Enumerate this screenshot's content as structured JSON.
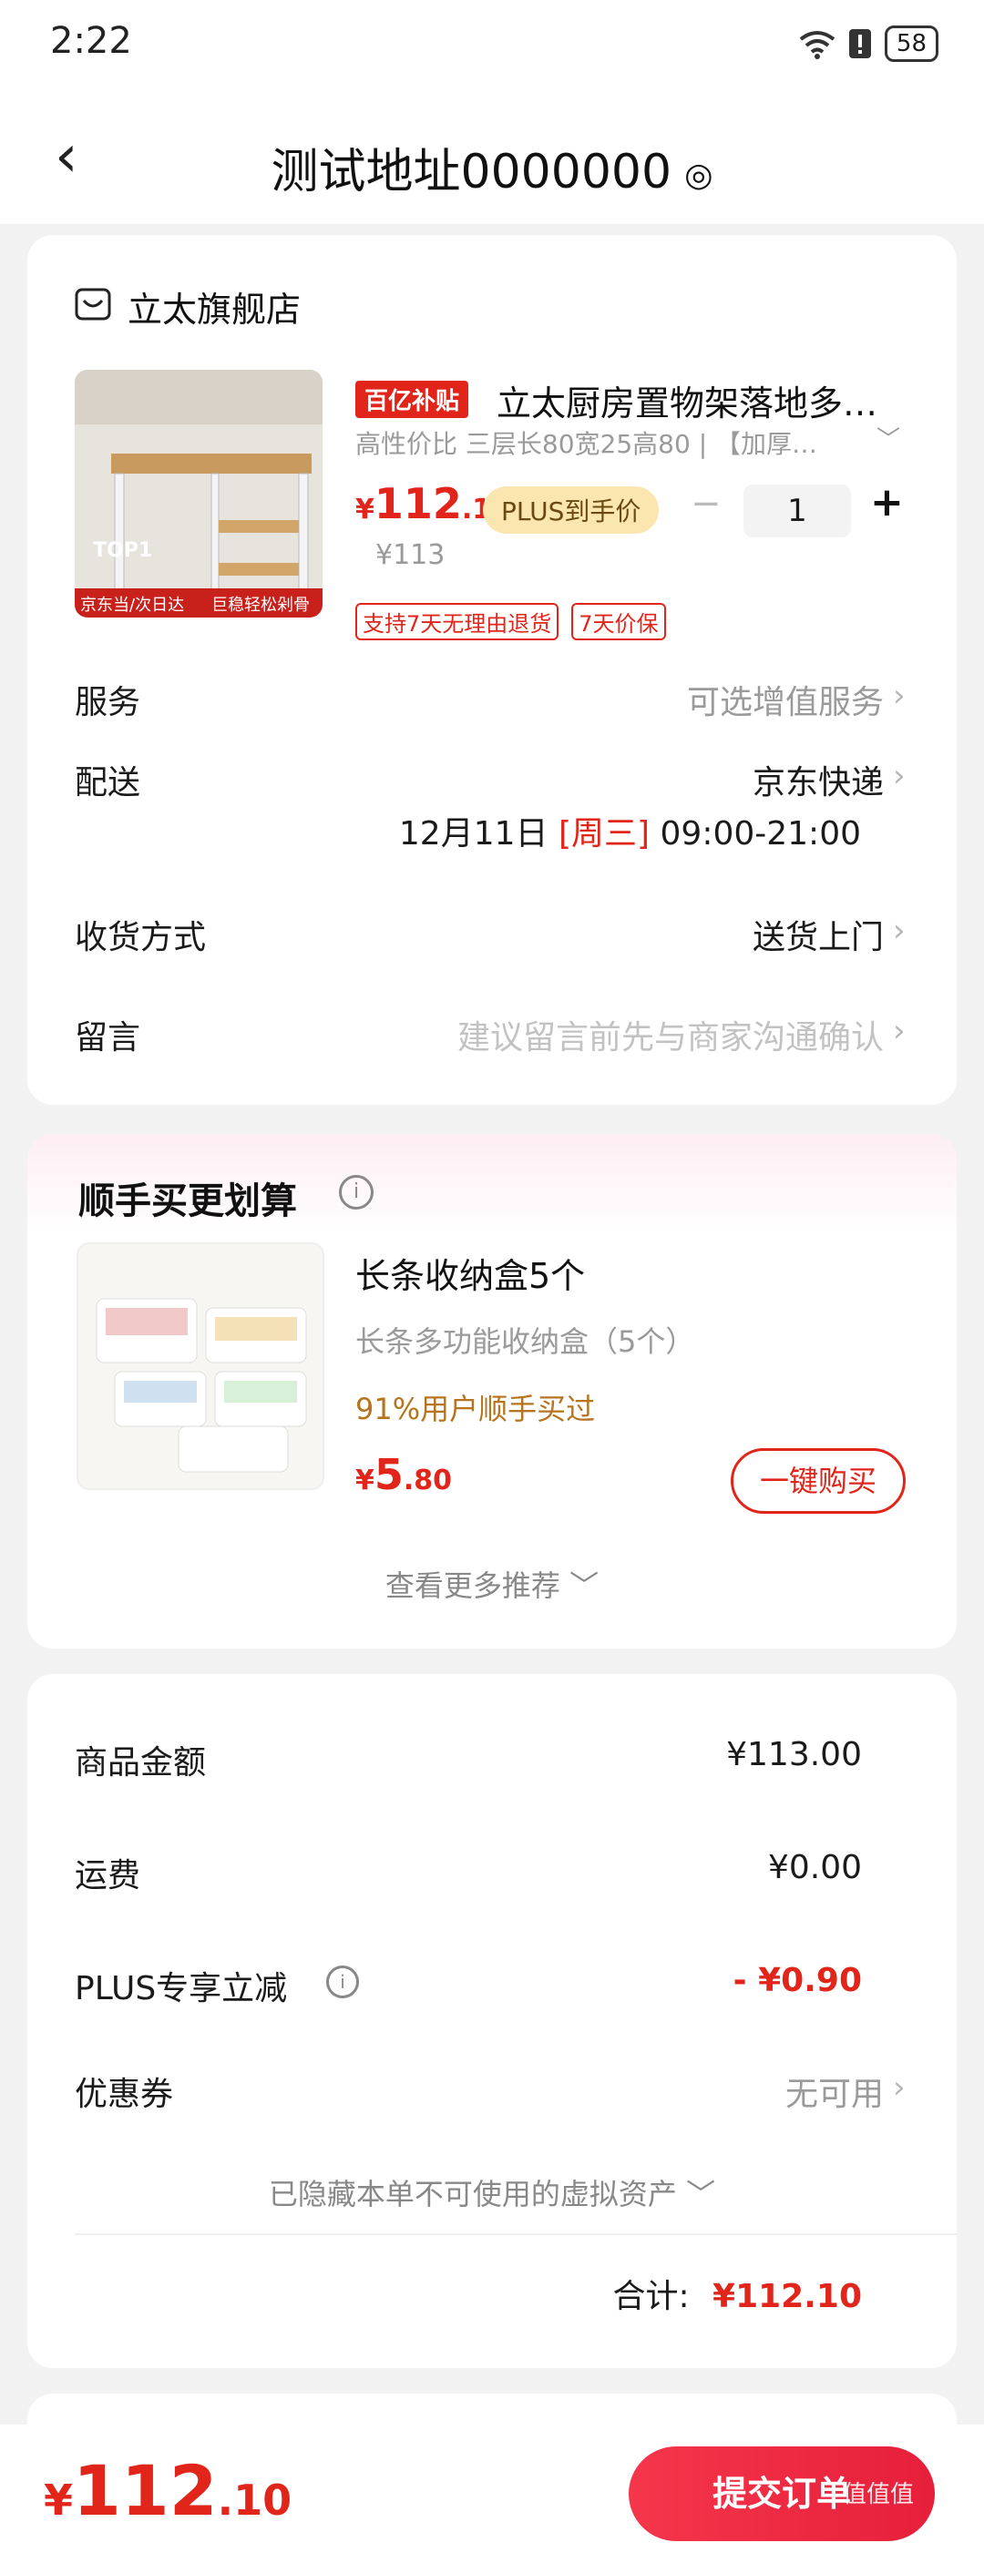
{
  "status": {
    "time": "2:22",
    "battery": "58"
  },
  "header": {
    "title": "测试地址0000000"
  },
  "store": {
    "name": "立太旗舰店",
    "product": {
      "badge": "百亿补贴",
      "title": "立太厨房置物架落地多…",
      "spec": "高性价比 三层长80宽25高80 | 【加厚…",
      "price_int": "112",
      "price_dec": ".1",
      "plus_label": "PLUS到手价",
      "orig_price": "¥113",
      "qty": "1",
      "thumb_top_text": "TOP1",
      "thumb_bottom_text": "京东当/次日达",
      "thumb_bottom_text2": "巨稳轻松剁骨",
      "tags": [
        "支持7天无理由退货",
        "7天价保"
      ]
    },
    "rows": {
      "service_label": "服务",
      "service_value": "可选增值服务",
      "delivery_label": "配送",
      "delivery_value": "京东快递",
      "delivery_date": "12月11日",
      "delivery_weekday": "[周三]",
      "delivery_time": "09:00-21:00",
      "receive_label": "收货方式",
      "receive_value": "送货上门",
      "note_label": "留言",
      "note_placeholder": "建议留言前先与商家沟通确认"
    }
  },
  "addon": {
    "title": "顺手买更划算",
    "item_title": "长条收纳盒5个",
    "item_sub": "长条多功能收纳盒（5个）",
    "item_stat": "91%用户顺手买过",
    "price_int": "5",
    "price_dec": ".80",
    "buy_label": "一键购买",
    "more_label": "查看更多推荐"
  },
  "summary": {
    "goods_label": "商品金额",
    "goods_value": "¥113.00",
    "shipping_label": "运费",
    "shipping_value": "¥0.00",
    "plus_label": "PLUS专享立减",
    "plus_value": "- ¥0.90",
    "coupon_label": "优惠券",
    "coupon_value": "无可用",
    "hidden_assets": "已隐藏本单不可使用的虚拟资产",
    "total_label": "合计:",
    "total_value": "¥112.10"
  },
  "footer": {
    "currency": "¥",
    "price_int": "112",
    "price_dec": ".10",
    "submit_label": "提交订单",
    "watermark": "值值值"
  },
  "colors": {
    "accent": "#e1251b",
    "plus_pill": "#fbe6b0",
    "page_bg": "#f2f2f2"
  }
}
